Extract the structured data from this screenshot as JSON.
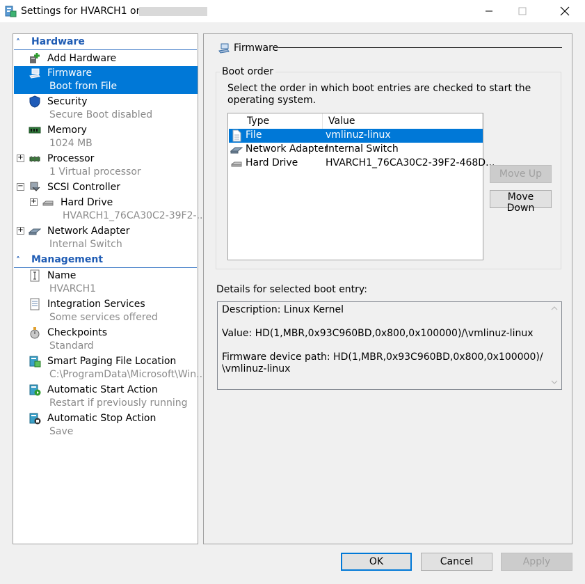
{
  "window": {
    "title": "Settings for HVARCH1 on",
    "minimize_icon": "minimize-icon",
    "maximize_icon": "maximize-icon",
    "close_icon": "close-icon"
  },
  "tree": {
    "hardware_header": "Hardware",
    "management_header": "Management",
    "items": [
      {
        "label": "Add Hardware",
        "sub": "",
        "icon": "add-hardware-icon"
      },
      {
        "label": "Firmware",
        "sub": "Boot from File",
        "icon": "firmware-icon"
      },
      {
        "label": "Security",
        "sub": "Secure Boot disabled",
        "icon": "shield-icon"
      },
      {
        "label": "Memory",
        "sub": "1024 MB",
        "icon": "memory-icon"
      },
      {
        "label": "Processor",
        "sub": "1 Virtual processor",
        "icon": "processor-icon"
      },
      {
        "label": "SCSI Controller",
        "sub": "",
        "icon": "scsi-controller-icon"
      },
      {
        "label": "Hard Drive",
        "sub": "HVARCH1_76CA30C2-39F2-...",
        "icon": "hard-drive-icon"
      },
      {
        "label": "Network Adapter",
        "sub": "Internal Switch",
        "icon": "network-adapter-icon"
      },
      {
        "label": "Name",
        "sub": "HVARCH1",
        "icon": "name-icon"
      },
      {
        "label": "Integration Services",
        "sub": "Some services offered",
        "icon": "integration-services-icon"
      },
      {
        "label": "Checkpoints",
        "sub": "Standard",
        "icon": "checkpoints-icon"
      },
      {
        "label": "Smart Paging File Location",
        "sub": "C:\\ProgramData\\Microsoft\\Win...",
        "icon": "smart-paging-icon"
      },
      {
        "label": "Automatic Start Action",
        "sub": "Restart if previously running",
        "icon": "auto-start-icon"
      },
      {
        "label": "Automatic Stop Action",
        "sub": "Save",
        "icon": "auto-stop-icon"
      }
    ]
  },
  "firmware": {
    "header": "Firmware",
    "boot_group_label": "Boot order",
    "boot_description": "Select the order in which boot entries are checked to start the operating system.",
    "columns": [
      "Type",
      "Value"
    ],
    "entries": [
      {
        "type": "File",
        "value": "vmlinuz-linux",
        "icon": "file-icon"
      },
      {
        "type": "Network Adapter",
        "value": "Internal Switch",
        "icon": "network-adapter-icon"
      },
      {
        "type": "Hard Drive",
        "value": "HVARCH1_76CA30C2-39F2-468D...",
        "icon": "hard-drive-icon"
      }
    ],
    "move_up_label": "Move Up",
    "move_down_label": "Move Down",
    "details_label": "Details for selected boot entry:",
    "details": {
      "description": "Description: Linux Kernel",
      "value": "Value: HD(1,MBR,0x93C960BD,0x800,0x100000)/\\vmlinuz-linux",
      "device_path_line1": "Firmware device path: HD(1,MBR,0x93C960BD,0x800,0x100000)/",
      "device_path_line2": "\\vmlinuz-linux"
    }
  },
  "buttons": {
    "ok": "OK",
    "cancel": "Cancel",
    "apply": "Apply"
  },
  "colors": {
    "selection": "#0078d7",
    "section_header": "#1f5cb4"
  }
}
